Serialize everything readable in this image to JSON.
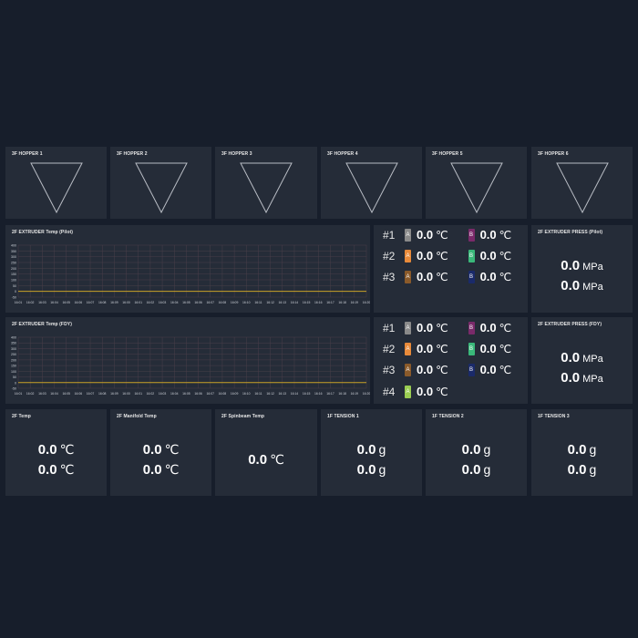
{
  "hoppers": [
    {
      "title": "3F HOPPER 1"
    },
    {
      "title": "3F HOPPER 2"
    },
    {
      "title": "3F HOPPER 3"
    },
    {
      "title": "3F HOPPER 4"
    },
    {
      "title": "3F HOPPER 5"
    },
    {
      "title": "3F HOPPER 6"
    }
  ],
  "chart_data": [
    {
      "type": "line",
      "title": "2F EXTRUDER Temp (Pilot)",
      "yticks": [
        "400",
        "350",
        "300",
        "250",
        "200",
        "150",
        "100",
        "50",
        "0",
        "-50"
      ],
      "x": [
        "16:01",
        "16:02",
        "16:03",
        "16:04",
        "16:05",
        "16:06",
        "16:07",
        "16:08",
        "16:09",
        "16:00",
        "16:01",
        "16:02",
        "16:03",
        "16:04",
        "16:05",
        "16:06",
        "16:07",
        "16:08",
        "16:09",
        "16:10",
        "16:11",
        "16:12",
        "16:13",
        "16:14",
        "16:15",
        "16:16",
        "16:17",
        "16:18",
        "16:19",
        "16:20"
      ],
      "ylim": [
        -50,
        400
      ],
      "series": [
        {
          "values": [
            0,
            0,
            0,
            0,
            0,
            0,
            0,
            0,
            0,
            0,
            0,
            0,
            0,
            0,
            0,
            0,
            0,
            0,
            0,
            0,
            0,
            0,
            0,
            0,
            0,
            0,
            0,
            0,
            0,
            0
          ],
          "color": "#c9a227"
        }
      ]
    },
    {
      "type": "line",
      "title": "2F EXTRUDER Temp (FDY)",
      "yticks": [
        "400",
        "350",
        "300",
        "250",
        "200",
        "150",
        "100",
        "50",
        "0",
        "-50"
      ],
      "x": [
        "16:01",
        "16:02",
        "16:03",
        "16:04",
        "16:05",
        "16:06",
        "16:07",
        "16:08",
        "16:09",
        "16:00",
        "16:01",
        "16:02",
        "16:03",
        "16:04",
        "16:05",
        "16:06",
        "16:07",
        "16:08",
        "16:09",
        "16:10",
        "16:11",
        "16:12",
        "16:13",
        "16:14",
        "16:15",
        "16:16",
        "16:17",
        "16:18",
        "16:19",
        "16:20"
      ],
      "ylim": [
        -50,
        400
      ],
      "series": [
        {
          "values": [
            0,
            0,
            0,
            0,
            0,
            0,
            0,
            0,
            0,
            0,
            0,
            0,
            0,
            0,
            0,
            0,
            0,
            0,
            0,
            0,
            0,
            0,
            0,
            0,
            0,
            0,
            0,
            0,
            0,
            0
          ],
          "color": "#c9a227"
        }
      ]
    }
  ],
  "legend_pilot": [
    {
      "idx": "#1",
      "a_tag": "A",
      "a_val": "0.0",
      "b_tag": "B",
      "b_val": "0.0",
      "unit": "℃"
    },
    {
      "idx": "#2",
      "a_tag": "A",
      "a_val": "0.0",
      "b_tag": "B",
      "b_val": "0.0",
      "unit": "℃"
    },
    {
      "idx": "#3",
      "a_tag": "A",
      "a_val": "0.0",
      "b_tag": "B",
      "b_val": "0.0",
      "unit": "℃"
    }
  ],
  "legend_fdy": [
    {
      "idx": "#1",
      "a_tag": "A",
      "a_val": "0.0",
      "b_tag": "B",
      "b_val": "0.0",
      "unit": "℃"
    },
    {
      "idx": "#2",
      "a_tag": "A",
      "a_val": "0.0",
      "b_tag": "B",
      "b_val": "0.0",
      "unit": "℃"
    },
    {
      "idx": "#3",
      "a_tag": "A",
      "a_val": "0.0",
      "b_tag": "B",
      "b_val": "0.0",
      "unit": "℃"
    },
    {
      "idx": "#4",
      "a_tag": "A",
      "a_val": "0.0",
      "unit": "℃"
    }
  ],
  "colors": {
    "row1a": "#8a8a8a",
    "row1b": "#7a2a6a",
    "row2a": "#e88a3a",
    "row2b": "#3ab87a",
    "row3a": "#8a5a2a",
    "row3b": "#1a2a6a",
    "row4a": "#9acd52"
  },
  "press_pilot": {
    "title": "2F EXTRUDER PRESS (Pilot)",
    "v1": "0.0",
    "v2": "0.0",
    "unit": "MPa"
  },
  "press_fdy": {
    "title": "2F EXTRUDER PRESS (FDY)",
    "v1": "0.0",
    "v2": "0.0",
    "unit": "MPa"
  },
  "bottom": [
    {
      "title": "2F Temp",
      "v1": "0.0",
      "v2": "0.0",
      "unit": "℃"
    },
    {
      "title": "2F Manifold Temp",
      "v1": "0.0",
      "v2": "0.0",
      "unit": "℃"
    },
    {
      "title": "2F Spinbeam Temp",
      "v1": "0.0",
      "unit": "℃"
    },
    {
      "title": "1F TENSION 1",
      "v1": "0.0",
      "v2": "0.0",
      "unit": "g"
    },
    {
      "title": "1F TENSION 2",
      "v1": "0.0",
      "v2": "0.0",
      "unit": "g"
    },
    {
      "title": "1F TENSION 3",
      "v1": "0.0",
      "v2": "0.0",
      "unit": "g"
    }
  ]
}
